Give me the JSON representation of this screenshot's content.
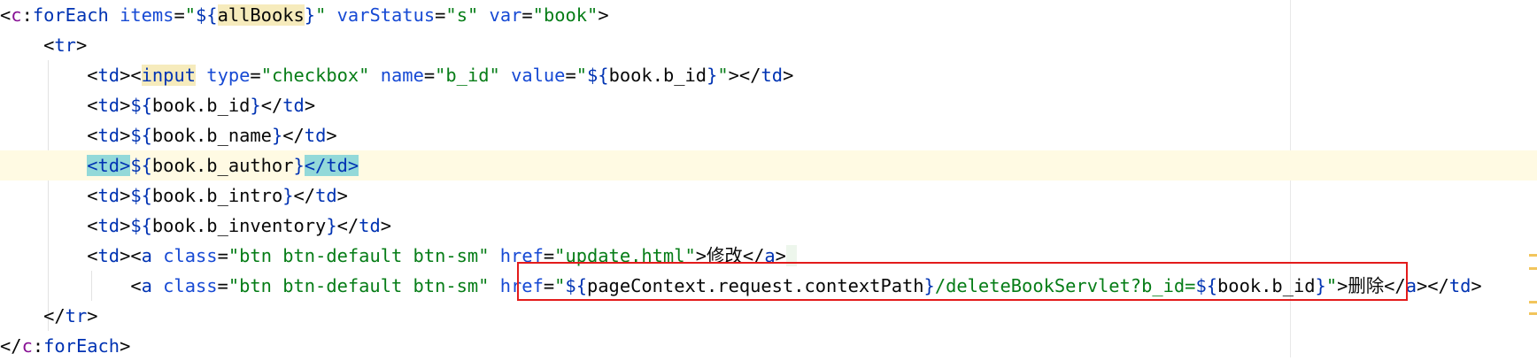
{
  "editor": {
    "lines": [
      {
        "segments": [
          {
            "t": "<",
            "c": "punct"
          },
          {
            "t": "c",
            "c": "ns"
          },
          {
            "t": ":",
            "c": "punct"
          },
          {
            "t": "forEach",
            "c": "tag"
          },
          {
            "t": " ",
            "c": "punct"
          },
          {
            "t": "items",
            "c": "attr"
          },
          {
            "t": "=",
            "c": "punct"
          },
          {
            "t": "\"",
            "c": "str"
          },
          {
            "t": "${",
            "c": "brace"
          },
          {
            "t": "allBooks",
            "c": "el hl-var"
          },
          {
            "t": "}",
            "c": "brace"
          },
          {
            "t": "\"",
            "c": "str"
          },
          {
            "t": " ",
            "c": "punct"
          },
          {
            "t": "varStatus",
            "c": "attr"
          },
          {
            "t": "=",
            "c": "punct"
          },
          {
            "t": "\"s\"",
            "c": "str"
          },
          {
            "t": " ",
            "c": "punct"
          },
          {
            "t": "var",
            "c": "attr"
          },
          {
            "t": "=",
            "c": "punct"
          },
          {
            "t": "\"book\"",
            "c": "str"
          },
          {
            "t": ">",
            "c": "punct"
          }
        ]
      },
      {
        "segments": [
          {
            "t": "    <",
            "c": "punct"
          },
          {
            "t": "tr",
            "c": "tag"
          },
          {
            "t": ">",
            "c": "punct"
          }
        ]
      },
      {
        "segments": [
          {
            "t": "        <",
            "c": "punct"
          },
          {
            "t": "td",
            "c": "tag"
          },
          {
            "t": "><",
            "c": "punct"
          },
          {
            "t": "input",
            "c": "tag hl-var"
          },
          {
            "t": " ",
            "c": "punct"
          },
          {
            "t": "type",
            "c": "attr"
          },
          {
            "t": "=",
            "c": "punct"
          },
          {
            "t": "\"checkbox\"",
            "c": "str"
          },
          {
            "t": " ",
            "c": "punct"
          },
          {
            "t": "name",
            "c": "attr"
          },
          {
            "t": "=",
            "c": "punct"
          },
          {
            "t": "\"b_id\"",
            "c": "str"
          },
          {
            "t": " ",
            "c": "punct"
          },
          {
            "t": "value",
            "c": "attr"
          },
          {
            "t": "=",
            "c": "punct"
          },
          {
            "t": "\"",
            "c": "str"
          },
          {
            "t": "${",
            "c": "brace"
          },
          {
            "t": "book.b_id",
            "c": "el"
          },
          {
            "t": "}",
            "c": "brace"
          },
          {
            "t": "\"",
            "c": "str"
          },
          {
            "t": "></",
            "c": "punct"
          },
          {
            "t": "td",
            "c": "tag"
          },
          {
            "t": ">",
            "c": "punct"
          }
        ]
      },
      {
        "segments": [
          {
            "t": "        <",
            "c": "punct"
          },
          {
            "t": "td",
            "c": "tag"
          },
          {
            "t": ">",
            "c": "punct"
          },
          {
            "t": "${",
            "c": "brace"
          },
          {
            "t": "book.b_id",
            "c": "el"
          },
          {
            "t": "}",
            "c": "brace"
          },
          {
            "t": "</",
            "c": "punct"
          },
          {
            "t": "td",
            "c": "tag"
          },
          {
            "t": ">",
            "c": "punct"
          }
        ]
      },
      {
        "segments": [
          {
            "t": "        <",
            "c": "punct"
          },
          {
            "t": "td",
            "c": "tag"
          },
          {
            "t": ">",
            "c": "punct"
          },
          {
            "t": "${",
            "c": "brace"
          },
          {
            "t": "book.b_name",
            "c": "el"
          },
          {
            "t": "}",
            "c": "brace"
          },
          {
            "t": "</",
            "c": "punct"
          },
          {
            "t": "td",
            "c": "tag"
          },
          {
            "t": ">",
            "c": "punct"
          }
        ]
      },
      {
        "current": true,
        "segments": [
          {
            "t": "        ",
            "c": "punct"
          },
          {
            "t": "<td>",
            "c": "tag hl-tagmatch"
          },
          {
            "t": "${",
            "c": "brace"
          },
          {
            "t": "book.b_author",
            "c": "el"
          },
          {
            "t": "}",
            "c": "brace"
          },
          {
            "t": "</td>",
            "c": "tag hl-tagmatch"
          }
        ]
      },
      {
        "segments": [
          {
            "t": "        <",
            "c": "punct"
          },
          {
            "t": "td",
            "c": "tag"
          },
          {
            "t": ">",
            "c": "punct"
          },
          {
            "t": "${",
            "c": "brace"
          },
          {
            "t": "book.b_intro",
            "c": "el"
          },
          {
            "t": "}",
            "c": "brace"
          },
          {
            "t": "</",
            "c": "punct"
          },
          {
            "t": "td",
            "c": "tag"
          },
          {
            "t": ">",
            "c": "punct"
          }
        ]
      },
      {
        "segments": [
          {
            "t": "        <",
            "c": "punct"
          },
          {
            "t": "td",
            "c": "tag"
          },
          {
            "t": ">",
            "c": "punct"
          },
          {
            "t": "${",
            "c": "brace"
          },
          {
            "t": "book.b_inventory",
            "c": "el"
          },
          {
            "t": "}",
            "c": "brace"
          },
          {
            "t": "</",
            "c": "punct"
          },
          {
            "t": "td",
            "c": "tag"
          },
          {
            "t": ">",
            "c": "punct"
          }
        ]
      },
      {
        "segments": [
          {
            "t": "        <",
            "c": "punct"
          },
          {
            "t": "td",
            "c": "tag"
          },
          {
            "t": "><",
            "c": "punct"
          },
          {
            "t": "a",
            "c": "tag"
          },
          {
            "t": " ",
            "c": "punct"
          },
          {
            "t": "class",
            "c": "attr"
          },
          {
            "t": "=",
            "c": "punct"
          },
          {
            "t": "\"btn btn-default btn-sm\"",
            "c": "str"
          },
          {
            "t": " ",
            "c": "punct"
          },
          {
            "t": "href",
            "c": "attr"
          },
          {
            "t": "=",
            "c": "punct"
          },
          {
            "t": "\"update.html\"",
            "c": "str"
          },
          {
            "t": ">",
            "c": "punct"
          },
          {
            "t": "修改",
            "c": "el cjk"
          },
          {
            "t": "</",
            "c": "punct"
          },
          {
            "t": "a",
            "c": "tag"
          },
          {
            "t": ">",
            "c": "punct"
          },
          {
            "t": " ",
            "c": "punct hl-faint"
          }
        ]
      },
      {
        "segments": [
          {
            "t": "            <",
            "c": "punct"
          },
          {
            "t": "a",
            "c": "tag"
          },
          {
            "t": " ",
            "c": "punct"
          },
          {
            "t": "class",
            "c": "attr"
          },
          {
            "t": "=",
            "c": "punct"
          },
          {
            "t": "\"btn btn-default btn-sm\"",
            "c": "str"
          },
          {
            "t": " ",
            "c": "punct"
          },
          {
            "t": "href",
            "c": "attr"
          },
          {
            "t": "=",
            "c": "punct"
          },
          {
            "t": "\"",
            "c": "str"
          },
          {
            "t": "${",
            "c": "brace"
          },
          {
            "t": "pageContext.request.contextPath",
            "c": "el"
          },
          {
            "t": "}",
            "c": "brace"
          },
          {
            "t": "/deleteBookServlet?b_id=",
            "c": "str"
          },
          {
            "t": "${",
            "c": "brace"
          },
          {
            "t": "book.b_id",
            "c": "el"
          },
          {
            "t": "}",
            "c": "brace"
          },
          {
            "t": "\"",
            "c": "str"
          },
          {
            "t": ">",
            "c": "punct"
          },
          {
            "t": "删除",
            "c": "el cjk"
          },
          {
            "t": "</",
            "c": "punct"
          },
          {
            "t": "a",
            "c": "tag"
          },
          {
            "t": "></",
            "c": "punct"
          },
          {
            "t": "td",
            "c": "tag"
          },
          {
            "t": ">",
            "c": "punct"
          }
        ]
      },
      {
        "segments": [
          {
            "t": "    </",
            "c": "punct"
          },
          {
            "t": "tr",
            "c": "tag"
          },
          {
            "t": ">",
            "c": "punct"
          }
        ]
      },
      {
        "segments": [
          {
            "t": "</",
            "c": "punct"
          },
          {
            "t": "c",
            "c": "ns"
          },
          {
            "t": ":",
            "c": "punct"
          },
          {
            "t": "forEach",
            "c": "tag"
          },
          {
            "t": ">",
            "c": "punct"
          }
        ]
      }
    ]
  },
  "colors": {
    "tag": "#0033b3",
    "attribute": "#174ad4",
    "string": "#067d17",
    "namespace": "#871094",
    "current_line": "#fffae3",
    "highlight_annotation": "#e31b1b"
  }
}
